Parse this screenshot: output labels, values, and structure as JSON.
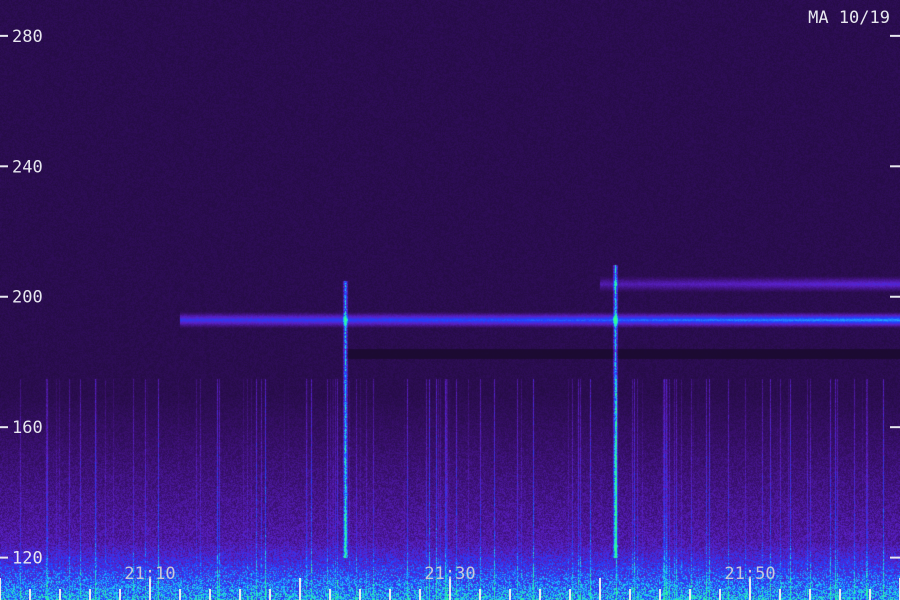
{
  "chart_data": {
    "type": "heatmap",
    "title": "MA 10/19",
    "xlabel": "",
    "ylabel": "",
    "y_ticks": [
      120,
      160,
      200,
      240,
      280
    ],
    "y_tick_labels": [
      "120",
      "160",
      "200",
      "240",
      "280"
    ],
    "x_tick_labels": [
      "21:10",
      "21:30",
      "21:50"
    ],
    "x_tick_values": [
      "21:10",
      "21:30",
      "21:50"
    ],
    "x_minor_ticks": [
      "21:00",
      "21:02",
      "21:04",
      "21:06",
      "21:08",
      "21:10",
      "21:12",
      "21:14",
      "21:16",
      "21:18",
      "21:20",
      "21:22",
      "21:24",
      "21:26",
      "21:28",
      "21:30",
      "21:32",
      "21:34",
      "21:36",
      "21:38",
      "21:40",
      "21:42",
      "21:44",
      "21:46",
      "21:48",
      "21:50",
      "21:52",
      "21:54",
      "21:56",
      "21:58",
      "22:00"
    ],
    "xlim": [
      "21:00",
      "22:00"
    ],
    "ylim": [
      107,
      291
    ],
    "colormap": [
      "#1a0a2e",
      "#3a1070",
      "#5a20c8",
      "#2040ff",
      "#20c8ff",
      "#30ff90"
    ],
    "features": [
      {
        "kind": "band",
        "y": 193,
        "x_start": "21:12",
        "x_end": "22:00",
        "intensity": 0.55
      },
      {
        "kind": "band",
        "y": 204,
        "x_start": "21:40",
        "x_end": "22:00",
        "intensity": 0.3
      },
      {
        "kind": "dark_band",
        "y_from": 181,
        "y_to": 184,
        "x_start": "21:23",
        "x_end": "22:00"
      },
      {
        "kind": "burst",
        "x": "21:23",
        "y_from": 120,
        "y_to": 205,
        "intensity": 0.9
      },
      {
        "kind": "burst",
        "x": "21:41",
        "y_from": 120,
        "y_to": 210,
        "intensity": 0.95
      }
    ]
  }
}
